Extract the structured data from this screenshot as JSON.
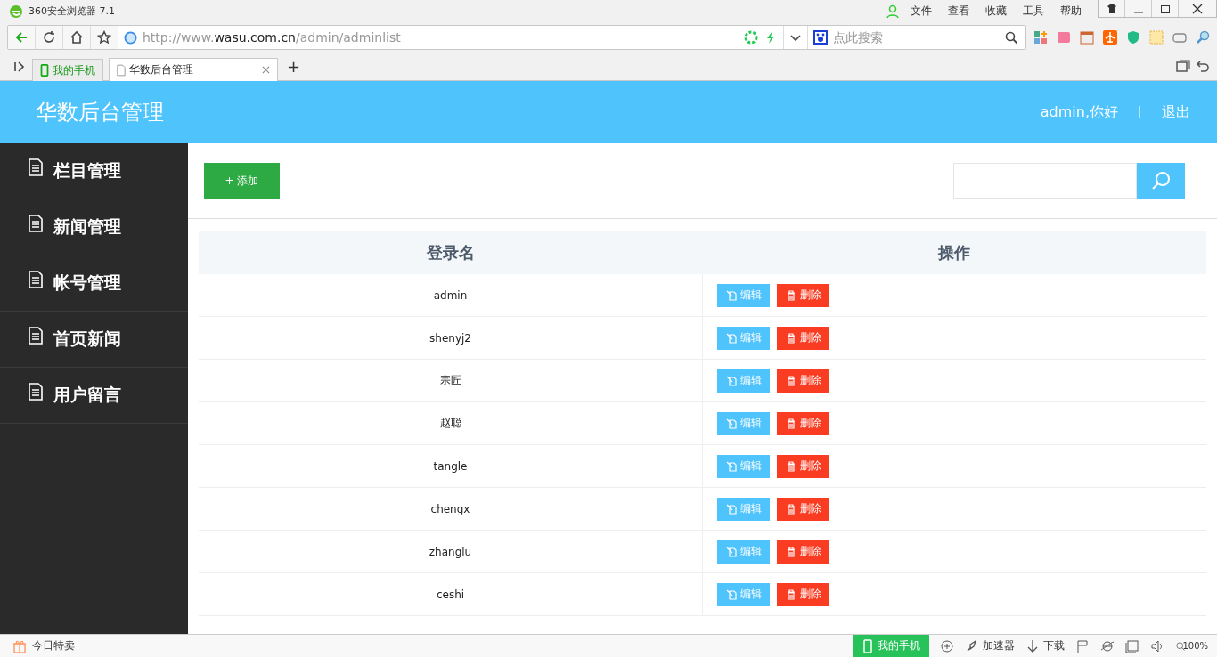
{
  "browser": {
    "title": "360安全浏览器 7.1",
    "menu": [
      "文件",
      "查看",
      "收藏",
      "工具",
      "帮助"
    ],
    "address": {
      "url_prefix": "http://www.",
      "url_domain": "wasu.com.cn",
      "url_path": "/admin/adminlist"
    },
    "search": {
      "placeholder": "点此搜索"
    },
    "tabs": [
      {
        "label": "我的手机",
        "kind": "phone",
        "selected": false
      },
      {
        "label": "华数后台管理",
        "kind": "page",
        "selected": true
      }
    ],
    "new_tab": "+",
    "status_bar": {
      "left": "今日特卖",
      "phone": "我的手机",
      "accelerator": "加速器",
      "download": "下载",
      "zoom": "100%"
    }
  },
  "header": {
    "title": "华数后台管理",
    "greeting": "admin,你好",
    "logout": "退出"
  },
  "sidebar": {
    "items": [
      {
        "label": "栏目管理",
        "selected": false
      },
      {
        "label": "新闻管理",
        "selected": false
      },
      {
        "label": "帐号管理",
        "selected": false
      },
      {
        "label": "首页新闻",
        "selected": false
      },
      {
        "label": "用户留言",
        "selected": false
      }
    ]
  },
  "toolbar": {
    "add_button": "+ 添加"
  },
  "table": {
    "columns": [
      "登录名",
      "操作"
    ],
    "rows": [
      {
        "name": "admin",
        "edit": "编辑",
        "delete": "删除"
      },
      {
        "name": "shenyj2",
        "edit": "编辑",
        "delete": "删除"
      },
      {
        "name": "宗匠",
        "edit": "编辑",
        "delete": "删除"
      },
      {
        "name": "赵聪",
        "edit": "编辑",
        "delete": "删除"
      },
      {
        "name": "tangle",
        "edit": "编辑",
        "delete": "删除"
      },
      {
        "name": "chengx",
        "edit": "编辑",
        "delete": "删除"
      },
      {
        "name": "zhanglu",
        "edit": "编辑",
        "delete": "删除"
      },
      {
        "name": "ceshi",
        "edit": "编辑",
        "delete": "删除"
      }
    ]
  }
}
